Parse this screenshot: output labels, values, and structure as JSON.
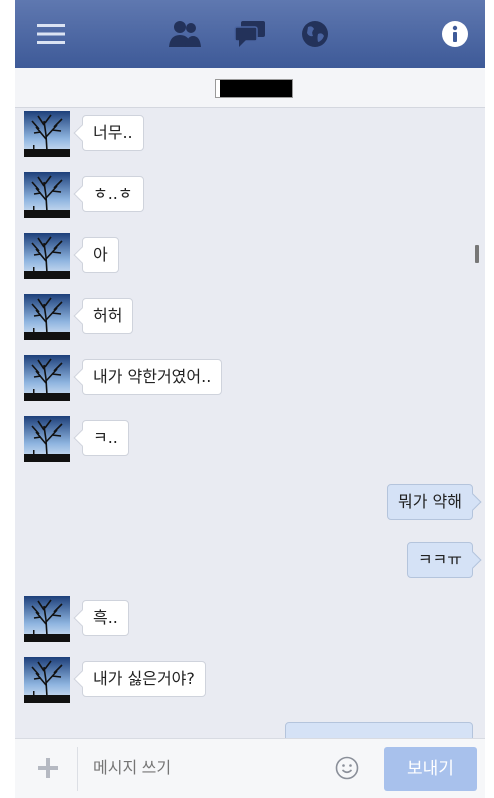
{
  "header": {
    "icons": [
      "menu-icon",
      "friends-icon",
      "messages-icon",
      "globe-icon",
      "info-icon"
    ],
    "bar_color": "#4a64a1"
  },
  "messages": [
    {
      "side": "in",
      "text": "너무.."
    },
    {
      "side": "in",
      "text": "ㅎ..ㅎ"
    },
    {
      "side": "in",
      "text": "아"
    },
    {
      "side": "in",
      "text": "허허"
    },
    {
      "side": "in",
      "text": "내가 약한거였어.."
    },
    {
      "side": "in",
      "text": "ㅋ.."
    },
    {
      "side": "out",
      "text": "뭐가 약해"
    },
    {
      "side": "out",
      "text": "ㅋㅋㅠ"
    },
    {
      "side": "in",
      "text": "흑.."
    },
    {
      "side": "in",
      "text": "내가 싫은거야?"
    }
  ],
  "composer": {
    "placeholder": "메시지 쓰기",
    "send_label": "보내기"
  }
}
